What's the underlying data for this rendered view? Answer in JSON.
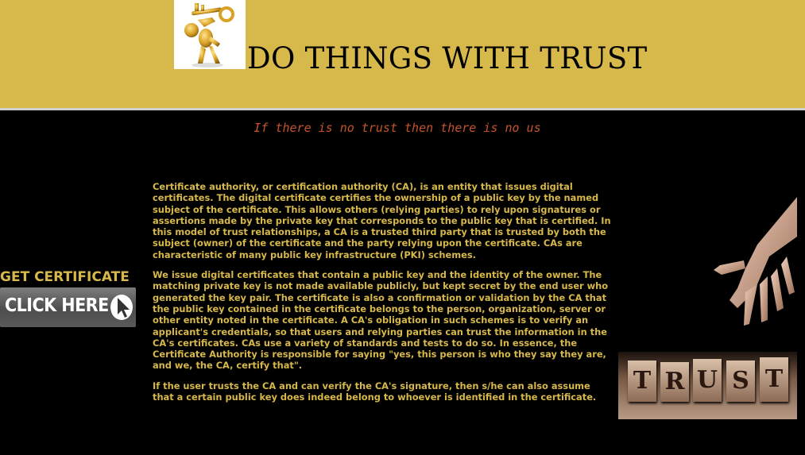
{
  "header": {
    "title": "DO THINGS WITH TRUST",
    "logo_icon": "golden-figure-holding-key-icon"
  },
  "tagline": "If there is no trust then there is no us",
  "cta": {
    "title": "GET CERTIFICATE",
    "button_label": "CLICK HERE",
    "cursor_icon": "mouse-pointer-icon"
  },
  "content": {
    "paragraphs": [
      "Certificate authority, or certification authority (CA), is an entity that issues digital certificates. The digital certificate certifies the ownership of a public key by the named subject of the certificate. This allows others (relying parties) to rely upon signatures or assertions made by the private key that corresponds to the public key that is certified. In this model of trust relationships, a CA is a trusted third party that is trusted by both the subject (owner) of the certificate and the party relying upon the certificate. CAs are characteristic of many public key infrastructure (PKI) schemes.",
      "We issue digital certificates that contain a public key and the identity of the owner. The matching private key is not made available publicly, but kept secret by the end user who generated the key pair. The certificate is also a confirmation or validation by the CA that the public key contained in the certificate belongs to the person, organization, server or other entity noted in the certificate. A CA's obligation in such schemes is to verify an applicant's credentials, so that users and relying parties can trust the information in the CA's certificates. CAs use a variety of standards and tests to do so. In essence, the Certificate Authority is responsible for saying \"yes, this person is who they say they are, and we, the CA, certify that\".",
      "If the user trusts the CA and can verify the CA's signature, then s/he can also assume that a certain public key does indeed belong to whoever is identified in the certificate."
    ]
  },
  "trust_image": {
    "blocks": [
      "T",
      "R",
      "U",
      "S",
      "T"
    ]
  },
  "colors": {
    "header_bg": "#d7b84a",
    "body_bg": "#000000",
    "gold_text": "#d7b84a",
    "tagline": "#c4542a"
  }
}
